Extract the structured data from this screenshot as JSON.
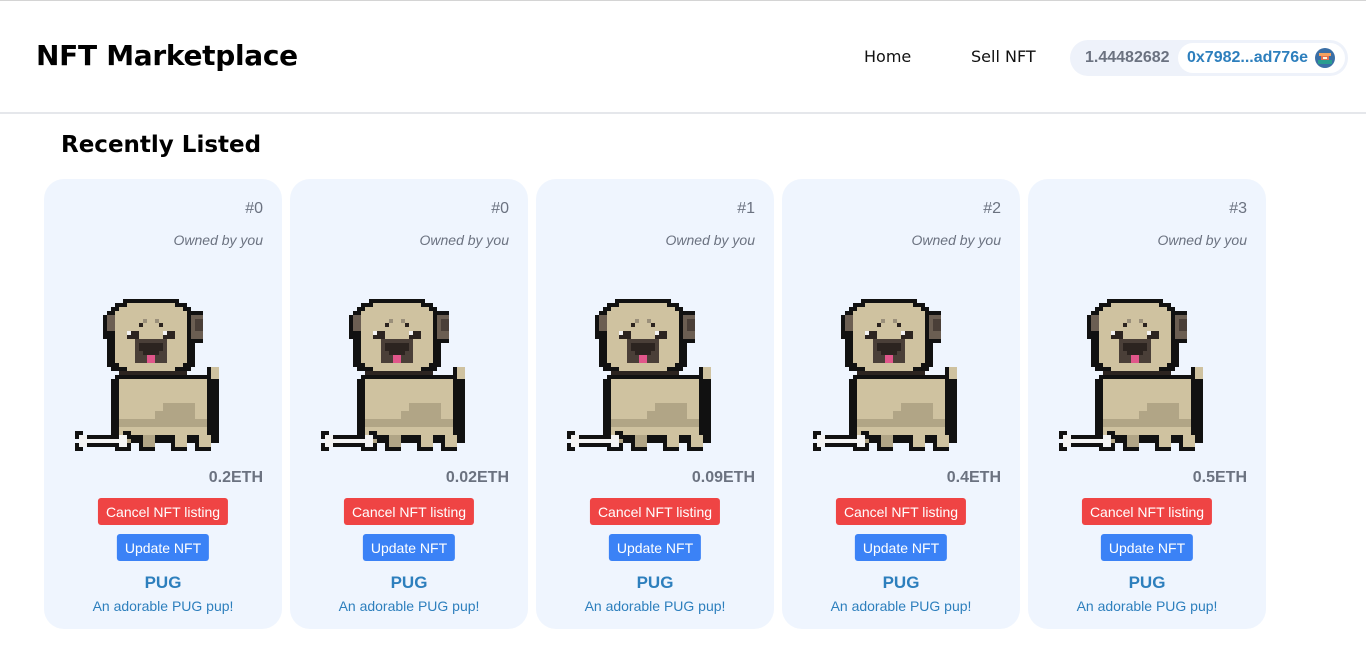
{
  "header": {
    "brand": "NFT Marketplace",
    "nav": {
      "home": "Home",
      "sell": "Sell NFT"
    },
    "wallet": {
      "balance": "1.44482682",
      "address": "0x7982...ad776e",
      "avatar_icon": "wallet-avatar-icon"
    }
  },
  "section": {
    "title": "Recently Listed"
  },
  "colors": {
    "card_bg": "#eff5fe",
    "cancel": "#ef4444",
    "update": "#3b82f6",
    "link": "#2d7fbd",
    "muted": "#6b7280"
  },
  "cards": [
    {
      "token": "#0",
      "owner": "Owned by you",
      "price": "0.2ETH",
      "cancel": "Cancel NFT listing",
      "update": "Update NFT",
      "name": "PUG",
      "description": "An adorable PUG pup!"
    },
    {
      "token": "#0",
      "owner": "Owned by you",
      "price": "0.02ETH",
      "cancel": "Cancel NFT listing",
      "update": "Update NFT",
      "name": "PUG",
      "description": "An adorable PUG pup!"
    },
    {
      "token": "#1",
      "owner": "Owned by you",
      "price": "0.09ETH",
      "cancel": "Cancel NFT listing",
      "update": "Update NFT",
      "name": "PUG",
      "description": "An adorable PUG pup!"
    },
    {
      "token": "#2",
      "owner": "Owned by you",
      "price": "0.4ETH",
      "cancel": "Cancel NFT listing",
      "update": "Update NFT",
      "name": "PUG",
      "description": "An adorable PUG pup!"
    },
    {
      "token": "#3",
      "owner": "Owned by you",
      "price": "0.5ETH",
      "cancel": "Cancel NFT listing",
      "update": "Update NFT",
      "name": "PUG",
      "description": "An adorable PUG pup!"
    }
  ]
}
